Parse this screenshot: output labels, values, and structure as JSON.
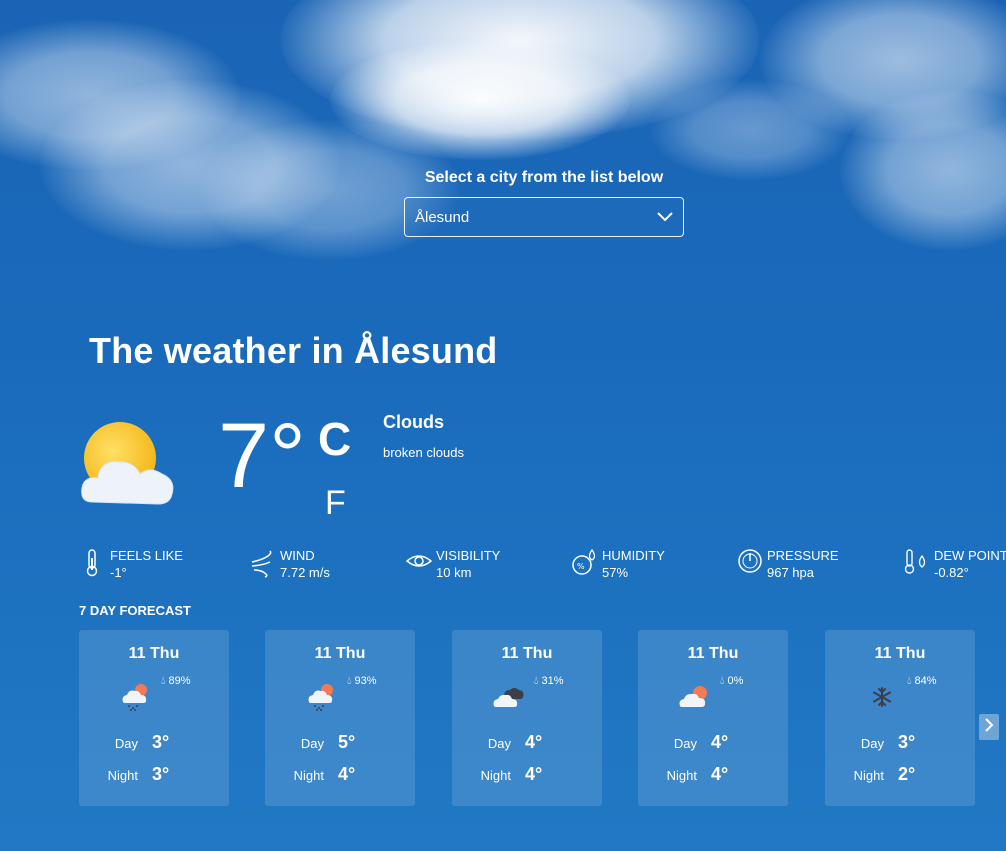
{
  "city_picker": {
    "label": "Select a city from the list below",
    "selected": "Ålesund"
  },
  "headline": "The weather in Ålesund",
  "current": {
    "temperature": "7°",
    "unit_c": "C",
    "unit_f": "F",
    "condition": "Clouds",
    "description": "broken clouds"
  },
  "stats": [
    {
      "label": "FEELS LIKE",
      "value": "-1°",
      "icon": "thermometer-icon"
    },
    {
      "label": "WIND",
      "value": "7.72 m/s",
      "icon": "wind-icon"
    },
    {
      "label": "VISIBILITY",
      "value": "10 km",
      "icon": "eye-icon"
    },
    {
      "label": "HUMIDITY",
      "value": "57%",
      "icon": "humidity-icon"
    },
    {
      "label": "PRESSURE",
      "value": "967 hpa",
      "icon": "gauge-icon"
    },
    {
      "label": "DEW POINT",
      "value": "-0.82°",
      "icon": "dew-point-icon"
    }
  ],
  "forecast_title": "7 DAY FORECAST",
  "forecast": [
    {
      "date": "11 Thu",
      "pop": "89%",
      "icon": "rain-cloud-sun-icon",
      "day_label": "Day",
      "day": "3°",
      "night_label": "Night",
      "night": "3°"
    },
    {
      "date": "11 Thu",
      "pop": "93%",
      "icon": "rain-cloud-sun-icon",
      "day_label": "Day",
      "day": "5°",
      "night_label": "Night",
      "night": "4°"
    },
    {
      "date": "11 Thu",
      "pop": "31%",
      "icon": "dark-clouds-icon",
      "day_label": "Day",
      "day": "4°",
      "night_label": "Night",
      "night": "4°"
    },
    {
      "date": "11 Thu",
      "pop": "0%",
      "icon": "cloud-sun-icon",
      "day_label": "Day",
      "day": "4°",
      "night_label": "Night",
      "night": "4°"
    },
    {
      "date": "11 Thu",
      "pop": "84%",
      "icon": "snowflake-icon",
      "day_label": "Day",
      "day": "3°",
      "night_label": "Night",
      "night": "2°"
    }
  ],
  "colors": {
    "background": "#1b67b7",
    "card": "rgba(255,255,255,0.13)",
    "sun": "#f6c22b",
    "sun_accent": "#f27a55"
  }
}
